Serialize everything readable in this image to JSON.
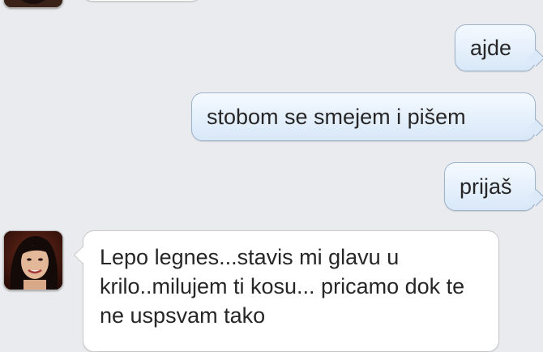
{
  "conversation": {
    "messages": [
      {
        "direction": "incoming",
        "text": ""
      },
      {
        "direction": "outgoing",
        "text": "ajde"
      },
      {
        "direction": "outgoing",
        "text": "stobom se smejem i pišem"
      },
      {
        "direction": "outgoing",
        "text": "prijaš"
      },
      {
        "direction": "incoming",
        "text": "Lepo legnes...stavis mi glavu u krilo..milujem ti kosu... pricamo dok te ne uspsvam tako"
      }
    ]
  },
  "colors": {
    "background": "#e9ebee",
    "outgoing_bubble": "#dbe9f8",
    "incoming_bubble": "#ffffff"
  },
  "icons": {
    "contact_avatar": "contact-avatar-icon"
  }
}
